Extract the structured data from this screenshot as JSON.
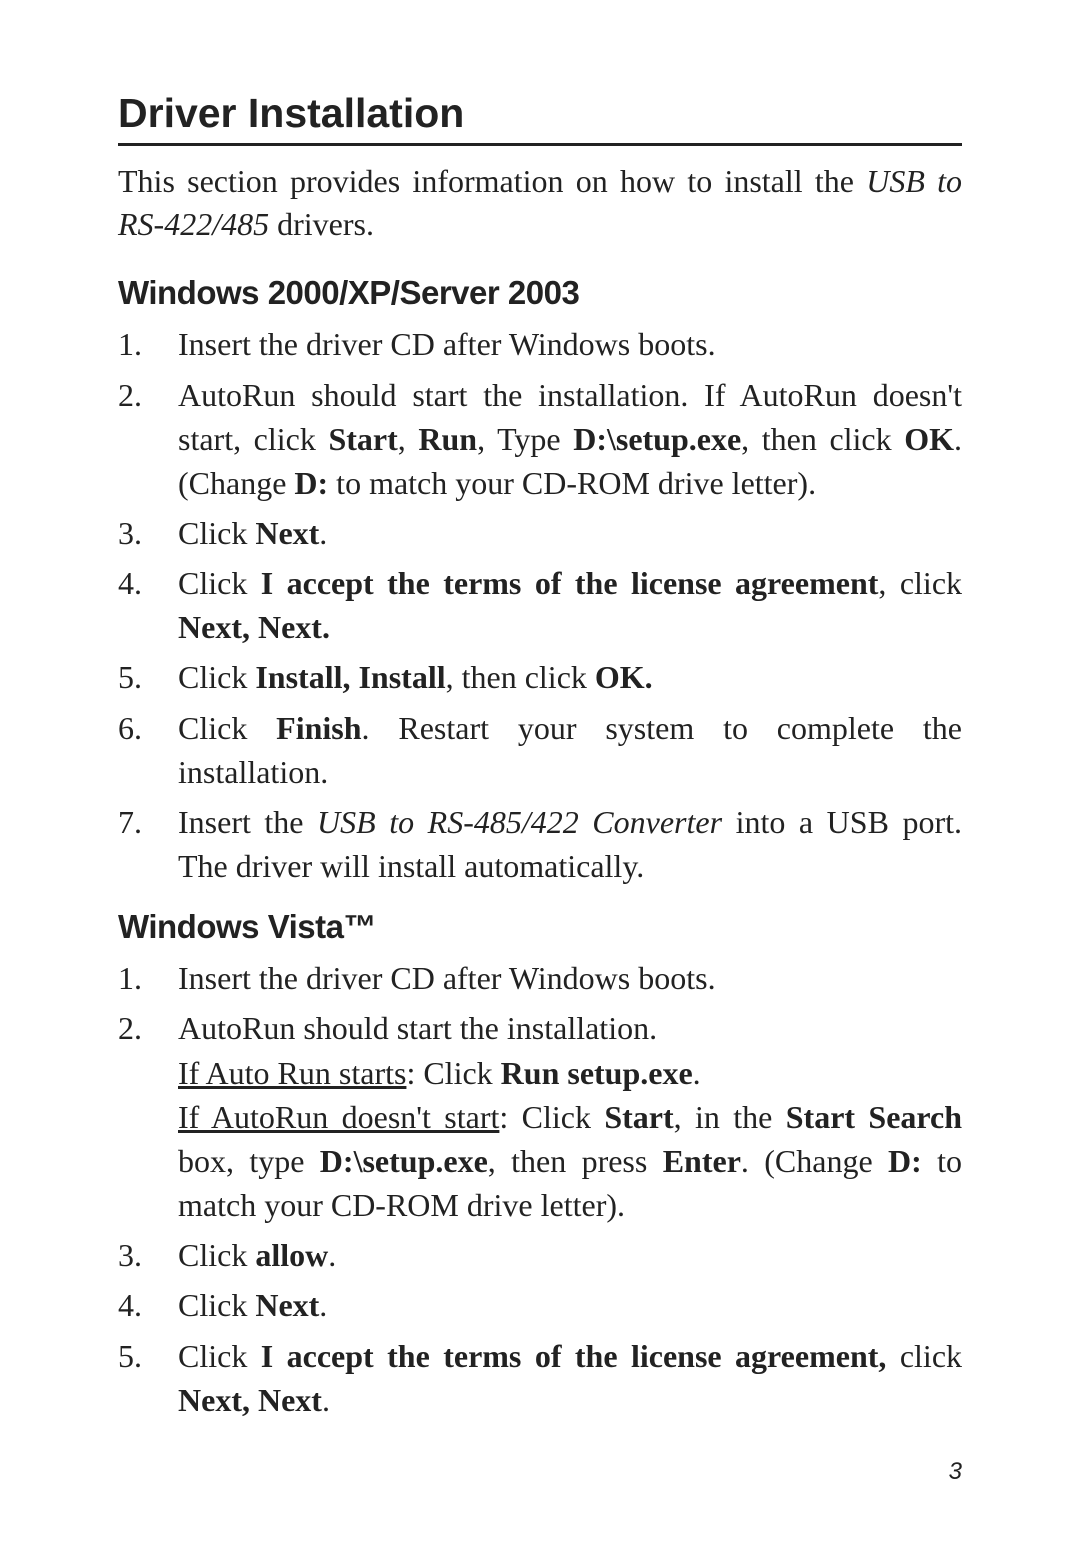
{
  "title": "Driver  Installation",
  "intro_pre": "This section provides information on how to install the ",
  "intro_italic": "USB to RS-422/485",
  "intro_post": " drivers.",
  "section1": {
    "heading": "Windows 2000/XP/Server 2003",
    "items": {
      "i1": "Insert the driver CD after Windows boots.",
      "i2_a": "AutoRun should start the installation. If AutoRun doesn't start, click ",
      "i2_b1": "Start",
      "i2_c": ", ",
      "i2_b2": "Run",
      "i2_d": ", Type ",
      "i2_b3": "D:\\setup.exe",
      "i2_e": ", then click ",
      "i2_b4": "OK",
      "i2_f": ". (Change ",
      "i2_b5": "D:",
      "i2_g": " to match your CD-ROM drive letter).",
      "i3_a": "Click ",
      "i3_b": "Next",
      "i3_c": ".",
      "i4_a": "Click ",
      "i4_b": "I accept the terms of the license agreement",
      "i4_c": ", click ",
      "i4_d": "Next, Next.",
      "i5_a": "Click ",
      "i5_b": "Install, Install",
      "i5_c": ", then click ",
      "i5_d": "OK.",
      "i6_a": "Click ",
      "i6_b": "Finish",
      "i6_c": ".  Restart your system to complete the installation.",
      "i7_a": "Insert the ",
      "i7_i": "USB to RS-485/422 Converter ",
      "i7_b": "into a USB port.  The driver will install automatically."
    }
  },
  "section2": {
    "heading": "Windows Vista™",
    "items": {
      "i1": "Insert the driver CD after Windows boots.",
      "i2_a": "AutoRun should start the installation.",
      "i2_u1": "If Auto Run starts",
      "i2_b": ":  Click ",
      "i2_b1": "Run setup.exe",
      "i2_c": ".",
      "i2_u2": "If AutoRun doesn't start",
      "i2_d": ":  Click ",
      "i2_b2": "Start",
      "i2_e": ", in the ",
      "i2_b3": "Start Search",
      "i2_f": " box, type ",
      "i2_b4": "D:\\setup.exe",
      "i2_g": ", then press ",
      "i2_b5": "Enter",
      "i2_h": ". (Change ",
      "i2_b6": "D:",
      "i2_i": " to match your CD-ROM drive letter).",
      "i3_a": "Click ",
      "i3_b": "allow",
      "i3_c": ".",
      "i4_a": "Click ",
      "i4_b": "Next",
      "i4_c": ".",
      "i5_a": "Click ",
      "i5_b": "I accept the terms of the license agreement,",
      "i5_c": " click ",
      "i5_d": "Next, Next",
      "i5_e": "."
    }
  },
  "pagenum": "3"
}
